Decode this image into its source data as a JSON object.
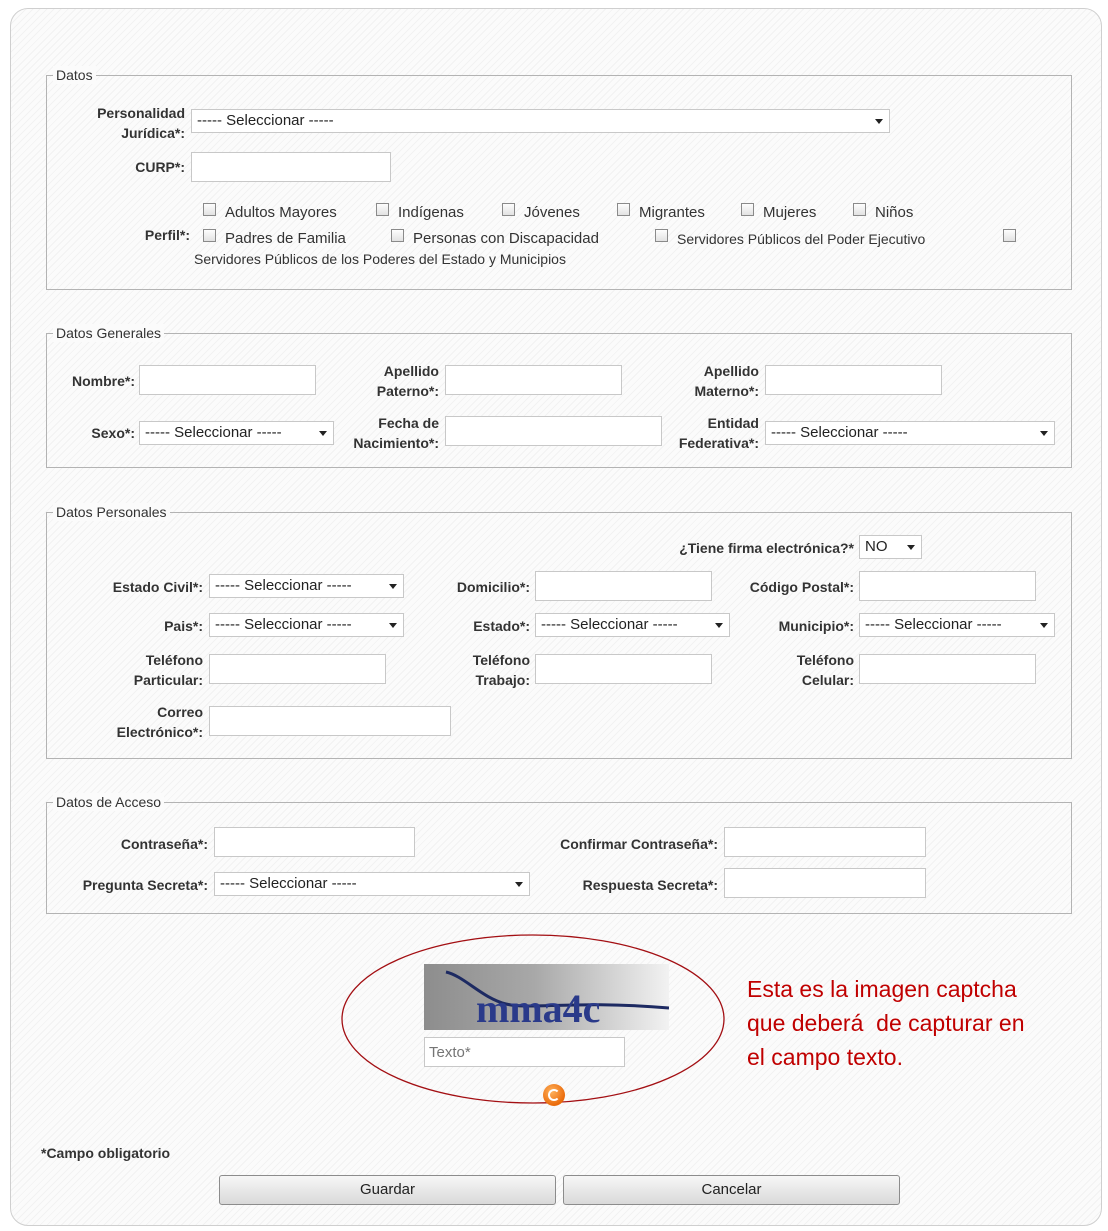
{
  "datos": {
    "legend": "Datos",
    "personalidad_label_1": "Personalidad",
    "personalidad_label_2": "Jurídica*:",
    "personalidad_value": "----- Seleccionar -----",
    "curp_label": "CURP*:",
    "curp_value": "",
    "perfil_label": "Perfil*:",
    "perfiles": [
      "Adultos Mayores",
      "Indígenas",
      "Jóvenes",
      "Migrantes",
      "Mujeres",
      "Niños",
      "Padres de Familia",
      "Personas con Discapacidad",
      "Servidores Públicos del Poder Ejecutivo",
      "Servidores Públicos de los Poderes del Estado y Municipios"
    ]
  },
  "datos_generales": {
    "legend": "Datos Generales",
    "nombre_label": "Nombre*:",
    "ap_paterno_label_1": "Apellido",
    "ap_paterno_label_2": "Paterno*:",
    "ap_materno_label_1": "Apellido",
    "ap_materno_label_2": "Materno*:",
    "sexo_label": "Sexo*:",
    "sexo_value": "----- Seleccionar -----",
    "fecha_label_1": "Fecha de",
    "fecha_label_2": "Nacimiento*:",
    "entidad_label_1": "Entidad",
    "entidad_label_2": "Federativa*:",
    "entidad_value": "----- Seleccionar -----"
  },
  "datos_personales": {
    "legend": "Datos Personales",
    "firma_label": "¿Tiene firma electrónica?*",
    "firma_value": "NO",
    "estado_civil_label": "Estado Civil*:",
    "estado_civil_value": "----- Seleccionar -----",
    "domicilio_label": "Domicilio*:",
    "cp_label": "Código Postal*:",
    "pais_label": "Pais*:",
    "pais_value": "----- Seleccionar -----",
    "estado_label": "Estado*:",
    "estado_value": "----- Seleccionar -----",
    "municipio_label": "Municipio*:",
    "municipio_value": "----- Seleccionar -----",
    "tel_part_label_1": "Teléfono",
    "tel_part_label_2": "Particular:",
    "tel_trab_label_1": "Teléfono",
    "tel_trab_label_2": "Trabajo:",
    "tel_cel_label_1": "Teléfono",
    "tel_cel_label_2": "Celular:",
    "correo_label_1": "Correo",
    "correo_label_2": "Electrónico*:"
  },
  "datos_acceso": {
    "legend": "Datos de Acceso",
    "contrasena_label": "Contraseña*:",
    "confirmar_label": "Confirmar Contraseña*:",
    "pregunta_label": "Pregunta Secreta*:",
    "pregunta_value": "----- Seleccionar -----",
    "respuesta_label": "Respuesta Secreta*:"
  },
  "captcha": {
    "image_text": "mma4c",
    "placeholder": "Texto*",
    "refresh_icon": "refresh-icon",
    "annotation_line_1": "Esta es la imagen captcha",
    "annotation_line_2": "que deberá  de capturar en",
    "annotation_line_3": "el campo texto.",
    "annotation_color": "#c00000"
  },
  "footer": {
    "required_note": "*Campo obligatorio",
    "save_label": "Guardar",
    "cancel_label": "Cancelar"
  }
}
